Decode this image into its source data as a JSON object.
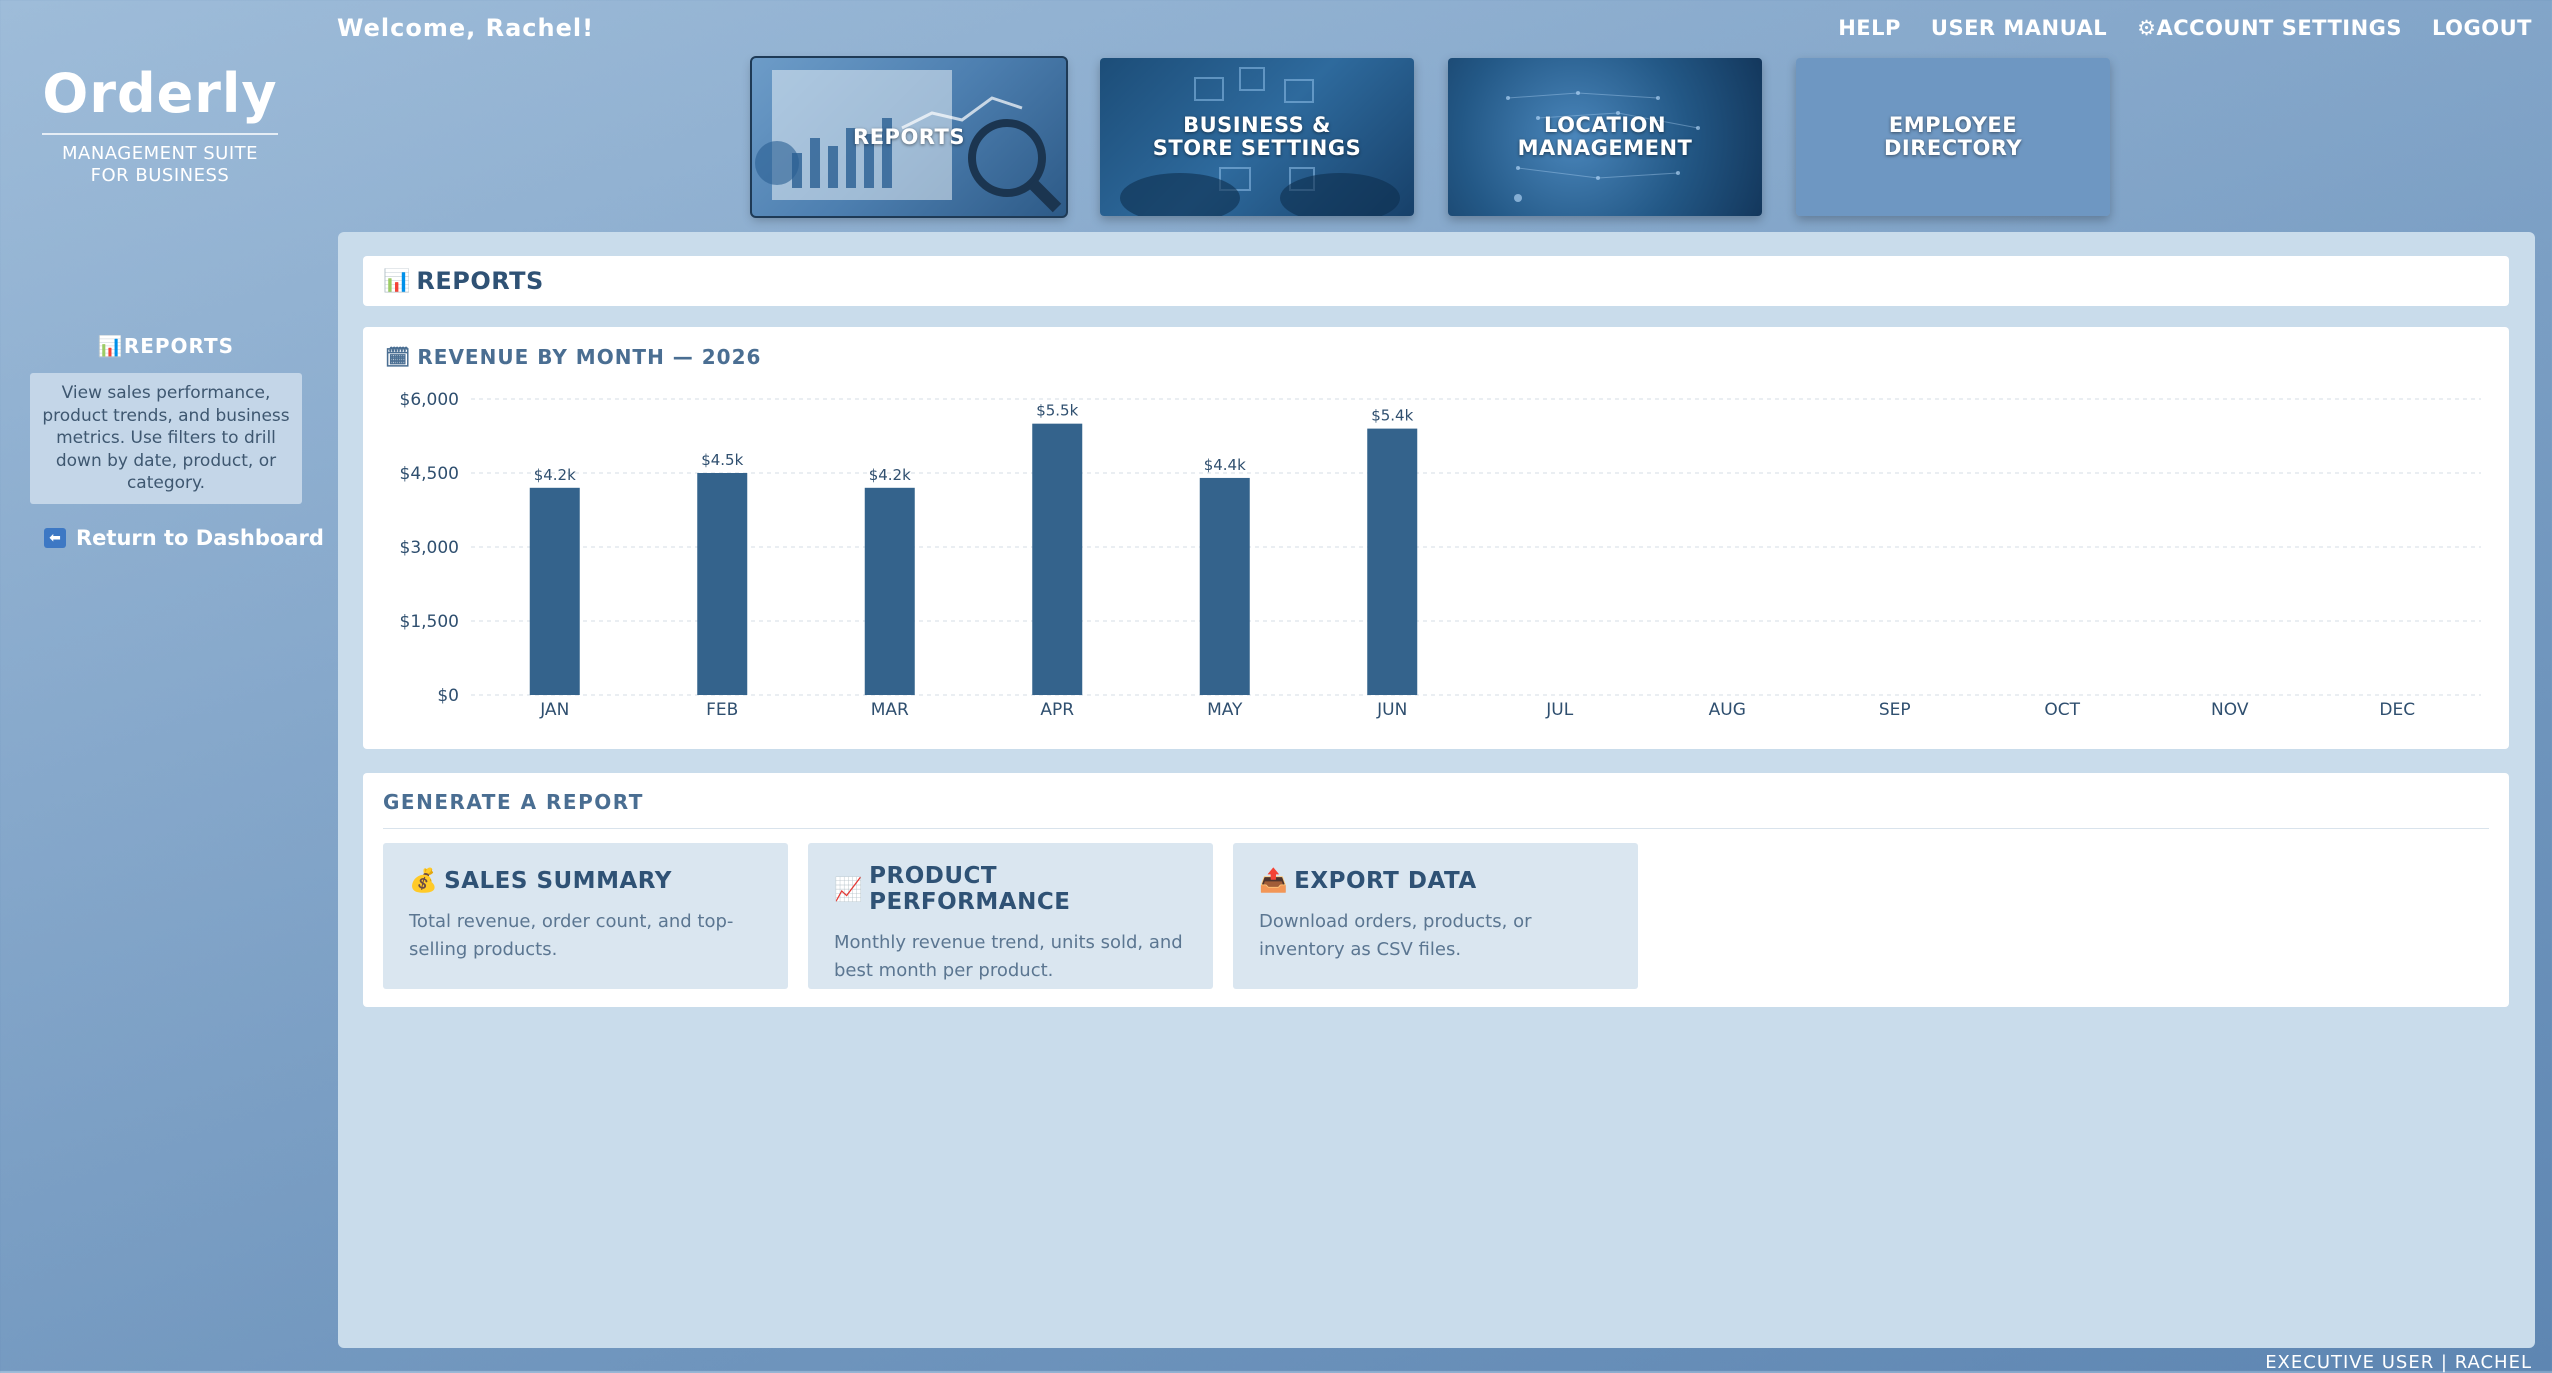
{
  "brand": {
    "name": "Orderly",
    "tagline_line1": "MANAGEMENT SUITE",
    "tagline_line2": "FOR BUSINESS"
  },
  "header": {
    "welcome": "Welcome, Rachel!",
    "nav": {
      "help": "HELP",
      "user_manual": "USER MANUAL",
      "account_settings": "ACCOUNT SETTINGS",
      "logout": "LOGOUT"
    }
  },
  "tiles": [
    {
      "line1": "REPORTS",
      "line2": ""
    },
    {
      "line1": "BUSINESS &",
      "line2": "STORE SETTINGS"
    },
    {
      "line1": "LOCATION",
      "line2": "MANAGEMENT"
    },
    {
      "line1": "EMPLOYEE",
      "line2": "DIRECTORY"
    }
  ],
  "sidebar": {
    "title": "REPORTS",
    "description": "View sales performance, product trends, and business metrics. Use filters to drill down by date, product, or category.",
    "return_link": "Return to Dashboard"
  },
  "main": {
    "header_title": "REPORTS",
    "chart_title": "REVENUE BY MONTH — 2026",
    "generate_title": "GENERATE A REPORT",
    "cards": [
      {
        "title": "SALES SUMMARY",
        "description": "Total revenue, order count, and top-selling products.",
        "icon": "money-bag-icon"
      },
      {
        "title": "PRODUCT PERFORMANCE",
        "description": "Monthly revenue trend, units sold, and best month per product.",
        "icon": "chart-trend-icon"
      },
      {
        "title": "EXPORT DATA",
        "description": "Download orders, products, or inventory as CSV files.",
        "icon": "export-icon"
      }
    ]
  },
  "footer": {
    "user": "EXECUTIVE USER | RACHEL"
  },
  "colors": {
    "bar": "#34638c",
    "accent": "#2f5275",
    "panel_bg": "#c9dceb"
  },
  "chart_data": {
    "type": "bar",
    "title": "REVENUE BY MONTH — 2026",
    "categories": [
      "JAN",
      "FEB",
      "MAR",
      "APR",
      "MAY",
      "JUN",
      "JUL",
      "AUG",
      "SEP",
      "OCT",
      "NOV",
      "DEC"
    ],
    "values": [
      4200,
      4500,
      4200,
      5500,
      4400,
      5400,
      null,
      null,
      null,
      null,
      null,
      null
    ],
    "data_labels": [
      "$4.2k",
      "$4.5k",
      "$4.2k",
      "$5.5k",
      "$4.4k",
      "$5.4k",
      "",
      "",
      "",
      "",
      "",
      ""
    ],
    "yticks": [
      0,
      1500,
      3000,
      4500,
      6000
    ],
    "ytick_labels": [
      "$0",
      "$1,500",
      "$3,000",
      "$4,500",
      "$6,000"
    ],
    "ylim": [
      0,
      6000
    ],
    "grid": true,
    "xlabel": "",
    "ylabel": ""
  }
}
